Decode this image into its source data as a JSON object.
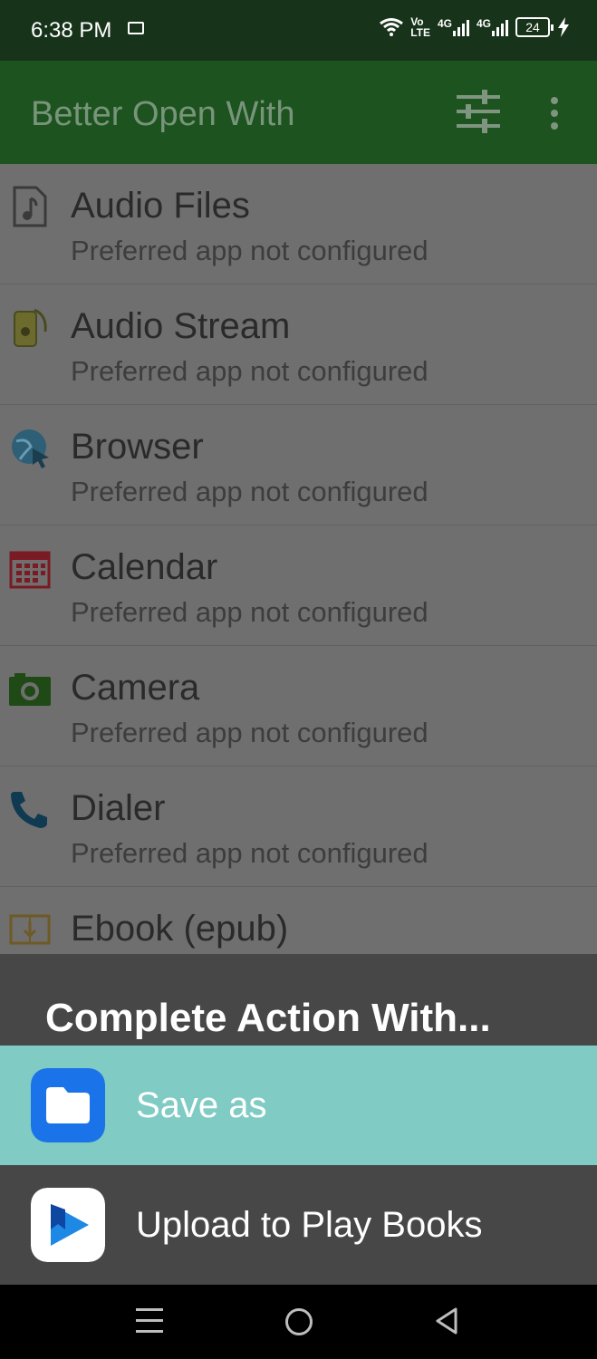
{
  "status_bar": {
    "time": "6:38 PM",
    "volte_top": "Vo",
    "volte_bottom": "LTE",
    "net1": "4G",
    "net2": "4G",
    "battery": "24"
  },
  "app_bar": {
    "title": "Better Open With",
    "icons": [
      "tune-icon",
      "more-vert-icon"
    ]
  },
  "list": {
    "items": [
      {
        "label": "Audio Files",
        "sub": "Preferred app not configured",
        "icon": "audio-file-icon"
      },
      {
        "label": "Audio Stream",
        "sub": "Preferred app not configured",
        "icon": "audio-stream-icon"
      },
      {
        "label": "Browser",
        "sub": "Preferred app not configured",
        "icon": "browser-icon"
      },
      {
        "label": "Calendar",
        "sub": "Preferred app not configured",
        "icon": "calendar-icon"
      },
      {
        "label": "Camera",
        "sub": "Preferred app not configured",
        "icon": "camera-icon"
      },
      {
        "label": "Dialer",
        "sub": "Preferred app not configured",
        "icon": "phone-icon"
      },
      {
        "label": "Ebook (epub)",
        "icon": "ebook-icon"
      }
    ]
  },
  "sheet": {
    "title": "Complete Action With...",
    "options": [
      {
        "label": "Save as",
        "icon": "files-folder-icon",
        "highlighted": true
      },
      {
        "label": "Upload to Play Books",
        "icon": "play-books-icon",
        "highlighted": false
      }
    ]
  },
  "colors": {
    "status_bar": "#17331a",
    "app_bar": "#1c531f",
    "highlight": "#80cbc4",
    "sheet": "#474747"
  }
}
